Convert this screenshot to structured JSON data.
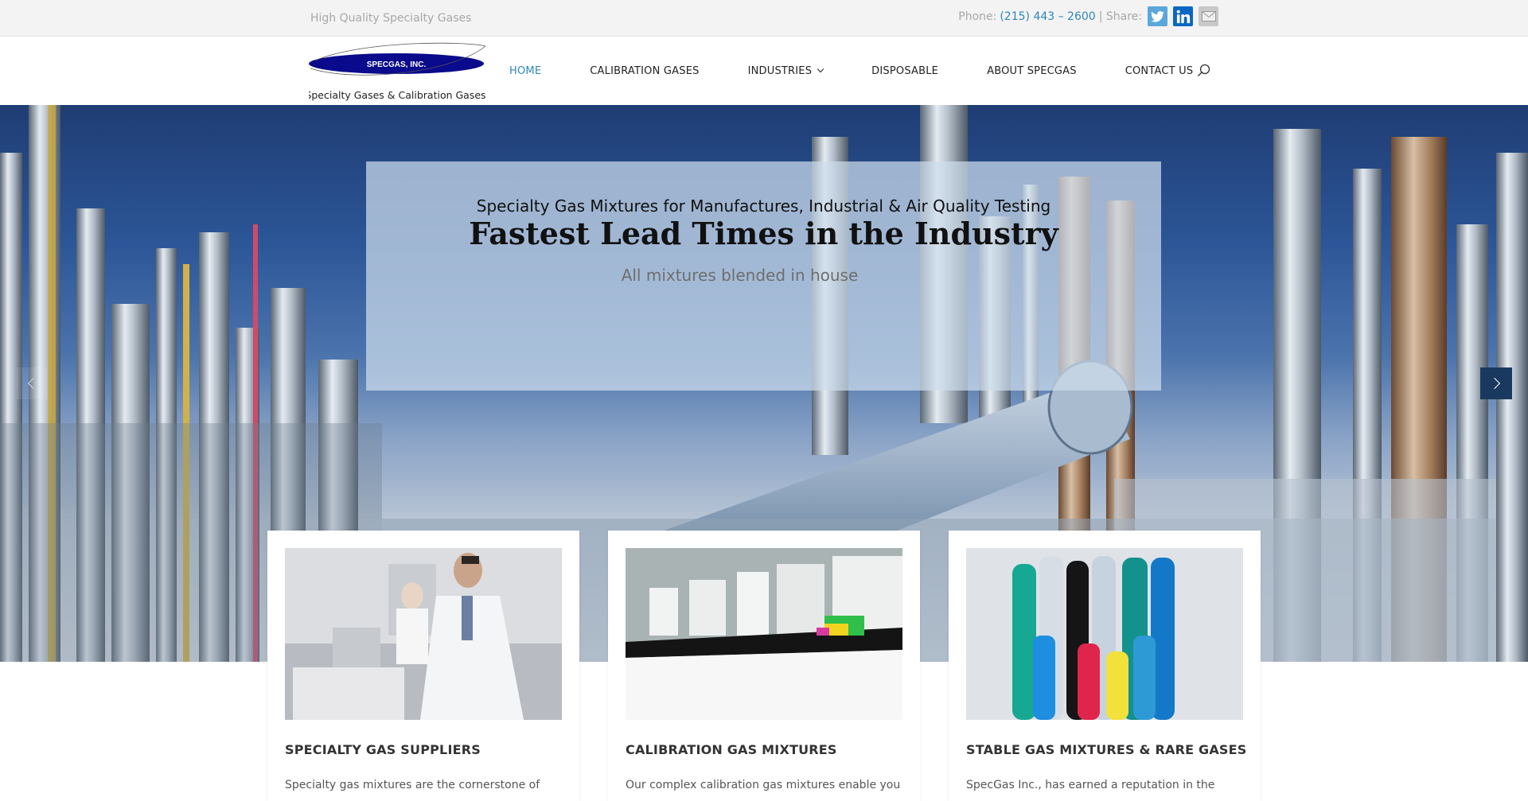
{
  "topbar": {
    "tagline": "High Quality Specialty Gases",
    "phone_label": "Phone:",
    "phone_number": "(215) 443 – 2600",
    "share_label": "| Share:",
    "social": [
      "twitter-icon",
      "linkedin-icon",
      "email-icon"
    ]
  },
  "logo": {
    "brand": "SPECGAS, INC.",
    "subtitle": "Specialty Gases & Calibration Gases"
  },
  "nav": {
    "items": [
      {
        "label": "HOME",
        "active": true
      },
      {
        "label": "CALIBRATION GASES"
      },
      {
        "label": "INDUSTRIES",
        "dropdown": true
      },
      {
        "label": "DISPOSABLE"
      },
      {
        "label": "ABOUT SPECGAS"
      },
      {
        "label": "CONTACT US"
      }
    ],
    "search_icon": "search-icon"
  },
  "hero": {
    "subtitle": "Specialty Gas Mixtures for Manufactures, Industrial & Air Quality Testing",
    "title": "Fastest Lead Times in the Industry",
    "description": "All mixtures blended in house",
    "prev_icon": "chevron-left-icon",
    "next_icon": "chevron-right-icon"
  },
  "cards": [
    {
      "title": "SPECIALTY GAS SUPPLIERS",
      "text": "Specialty gas mixtures are the cornerstone of"
    },
    {
      "title": "CALIBRATION GAS MIXTURES",
      "text": "Our complex calibration gas mixtures enable you to"
    },
    {
      "title": "STABLE GAS MIXTURES & RARE GASES",
      "text": "SpecGas Inc., has earned a reputation in the"
    }
  ],
  "colors": {
    "accent": "#2e86b8",
    "logo_blue": "#0a0a8c",
    "slider_next": "#193a5e"
  }
}
